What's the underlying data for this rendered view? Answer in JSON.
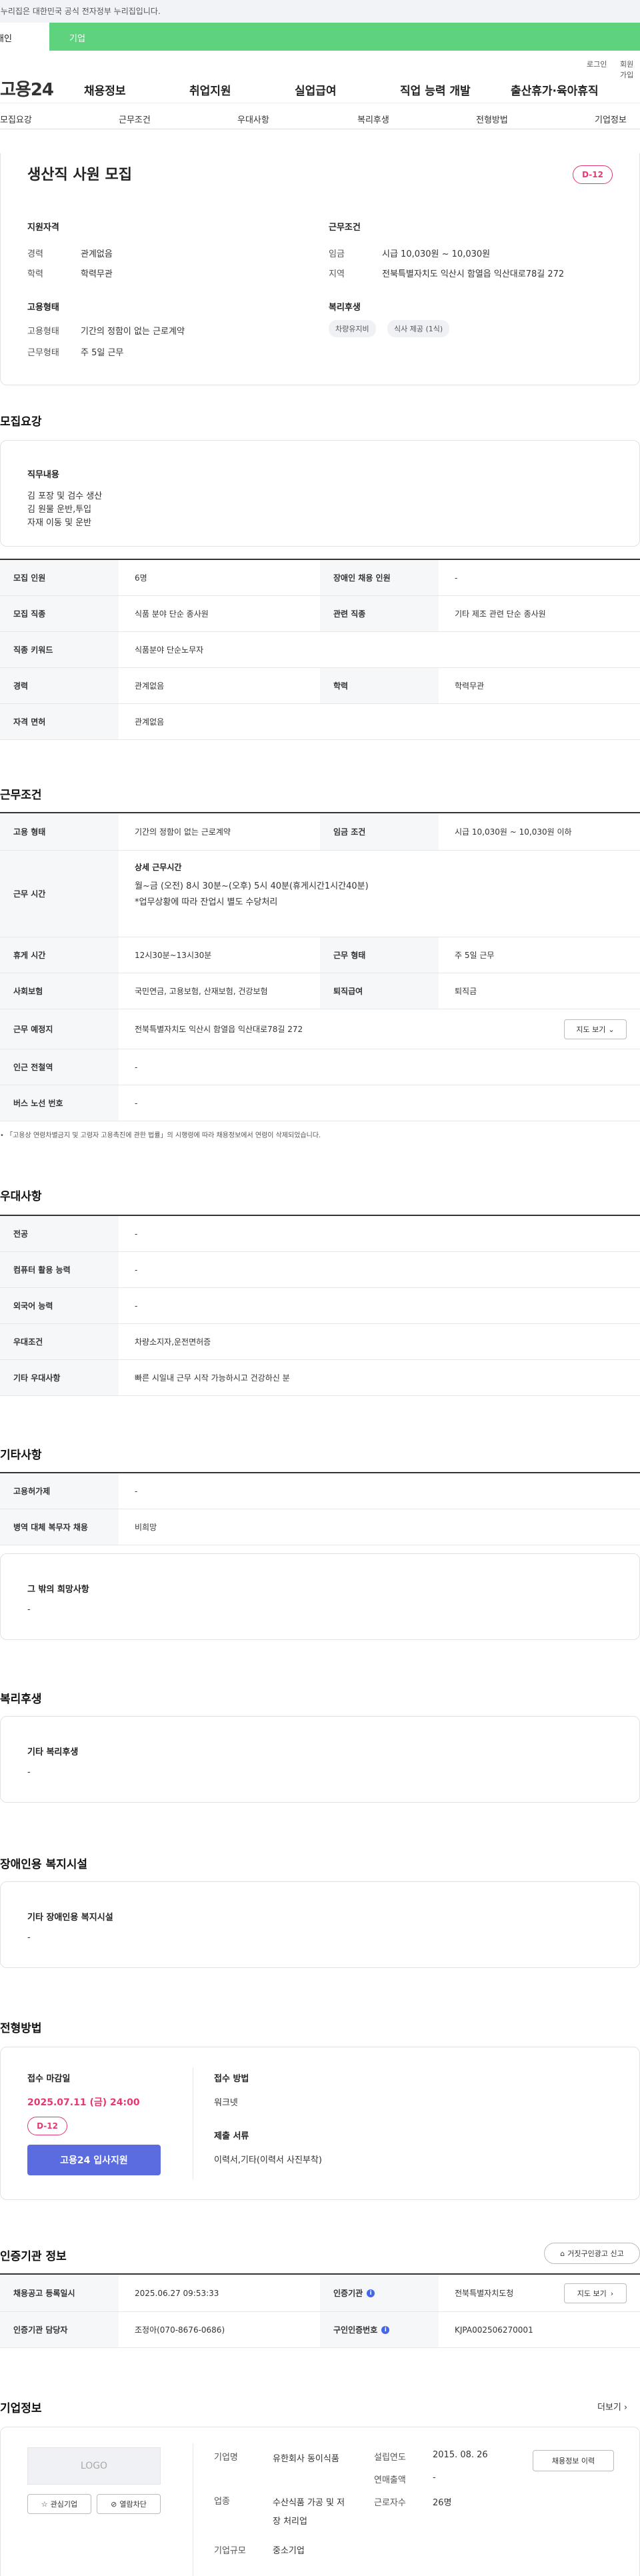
{
  "notice": "이 누리집은 대한민국 공식 전자정부 누리집입니다.",
  "tabs": {
    "personal": "개인",
    "company": "기업"
  },
  "util": {
    "login": "로그인",
    "join": "회원가입"
  },
  "gnb": {
    "logo": "고용24",
    "menu": [
      "채용정보",
      "취업지원",
      "실업급여",
      "직업 능력 개발",
      "출산휴가·육아휴직"
    ]
  },
  "snb": [
    "모집요강",
    "근무조건",
    "우대사항",
    "복리후생",
    "전형방법",
    "기업정보"
  ],
  "summary": {
    "title": "생산직 사원 모집",
    "dday": "D-12",
    "qual_title": "지원자격",
    "career_label": "경력",
    "career": "관계없음",
    "edu_label": "학력",
    "edu": "학력무관",
    "emp_title": "고용형태",
    "emptype_label": "고용형태",
    "emptype": "기간의 정함이 없는 근로계약",
    "worktype_label": "근무형태",
    "worktype": "주 5일 근무",
    "cond_title": "근무조건",
    "wage_label": "임금",
    "wage": "시급 10,030원 ~ 10,030원",
    "region_label": "지역",
    "region": "전북특별자치도 익산시 함열읍 익산대로78길 272",
    "welfare_title": "복리후생",
    "chips": [
      "차량유지비",
      "식사 제공 (1식)"
    ]
  },
  "recruit": {
    "heading": "모집요강",
    "duty_title": "직무내용",
    "duty_lines": [
      "김 포장 및 검수 생산",
      "김 원물 운반,투입",
      "자재 이동 및 운반"
    ],
    "rows": [
      {
        "k": "모집 인원",
        "v": "6명",
        "k2": "장애인 채용 인원",
        "v2": "-"
      },
      {
        "k": "모집 직종",
        "v": "식품 분야 단순 종사원",
        "k2": "관련 직종",
        "v2": "기타 제조 관련 단순 종사원"
      },
      {
        "k": "직종 키워드",
        "v": "식품분야 단순노무자"
      },
      {
        "k": "경력",
        "v": "관계없음",
        "k2": "학력",
        "v2": "학력무관"
      },
      {
        "k": "자격 면허",
        "v": "관계없음"
      }
    ]
  },
  "work": {
    "heading": "근무조건",
    "emptype_k": "고용 형태",
    "emptype_v": "기간의 정함이 없는 근로계약",
    "wage_k": "임금 조건",
    "wage_v": "시급 10,030원 ~ 10,030원 이하",
    "hours_k": "근무 시간",
    "hours_title": "상세 근무시간",
    "hours_line1": "월~금 (오전) 8시 30분~(오후) 5시 40분(휴게시간1시간40분)",
    "hours_line2": "*업무상황에 따라 잔업시 별도 수당처리",
    "break_k": "휴게 시간",
    "break_v": "12시30분~13시30분",
    "form_k": "근무 형태",
    "form_v": "주 5일 근무",
    "ins_k": "사회보험",
    "ins_v": "국민연금, 고용보험, 산재보험, 건강보험",
    "sev_k": "퇴직급여",
    "sev_v": "퇴직금",
    "place_k": "근무 예정지",
    "place_v": "전북특별자치도 익산시 함열읍 익산대로78길 272",
    "map_btn": "지도 보기",
    "subway_k": "인근 전철역",
    "subway_v": "-",
    "bus_k": "버스 노선 번호",
    "bus_v": "-",
    "note": "「고용상 연령차별금지 및 고령자 고용촉진에 관한 법률」의 시행령에 따라 채용정보에서 연령이 삭제되었습니다."
  },
  "pref": {
    "heading": "우대사항",
    "rows": [
      {
        "k": "전공",
        "v": "-"
      },
      {
        "k": "컴퓨터 활용 능력",
        "v": "-"
      },
      {
        "k": "외국어 능력",
        "v": "-"
      },
      {
        "k": "우대조건",
        "v": "차량소지자,운전면허증"
      },
      {
        "k": "기타 우대사항",
        "v": "빠른 시일내 근무 시작 가능하시고 건강하신 분"
      }
    ]
  },
  "etc": {
    "heading": "기타사항",
    "rows": [
      {
        "k": "고용허가제",
        "v": "-"
      },
      {
        "k": "병역 대체 복무자 채용",
        "v": "비희망"
      }
    ],
    "other_title": "그 밖의 희망사항",
    "other_value": "-"
  },
  "welfare": {
    "heading": "복리후생",
    "title": "기타 복리후생",
    "value": "-"
  },
  "disab": {
    "heading": "장애인용 복지시설",
    "title": "기타 장애인용 복지시설",
    "value": "-"
  },
  "process": {
    "heading": "전형방법",
    "deadline_label": "접수 마감일",
    "deadline": "2025.07.11 (금) 24:00",
    "dday": "D-12",
    "apply_btn": "고용24 입사지원",
    "method_label": "접수 방법",
    "method": "워크넷",
    "docs_label": "제출 서류",
    "docs": "이력서,기타(이력서 사진부착)"
  },
  "cert": {
    "heading": "인증기관 정보",
    "report_btn": "거짓구인광고 신고",
    "reg_k": "채용공고 등록일시",
    "reg_v": "2025.06.27 09:53:33",
    "org_k": "인증기관",
    "org_v": "전북특별자치도청",
    "map_btn": "지도 보기",
    "mgr_k": "인증기관 담당자",
    "mgr_v": "조정아(070-8676-0686)",
    "num_k": "구인인증번호",
    "num_v": "KJPA002506270001"
  },
  "company": {
    "heading": "기업정보",
    "more": "더보기",
    "logo": "LOGO",
    "fav_btn": "관심기업",
    "block_btn": "열람차단",
    "name_k": "기업명",
    "name_v": "유한회사 동이식품",
    "biz_k": "업종",
    "biz_v": "수산식품 가공 및 저장 처리업",
    "size_k": "기업규모",
    "size_v": "중소기업",
    "est_k": "설립연도",
    "est_v": "2015. 08. 26",
    "sales_k": "연매출액",
    "sales_v": "-",
    "emp_k": "근로자수",
    "emp_v": "26명",
    "jobs_btn": "채용정보 이력"
  }
}
